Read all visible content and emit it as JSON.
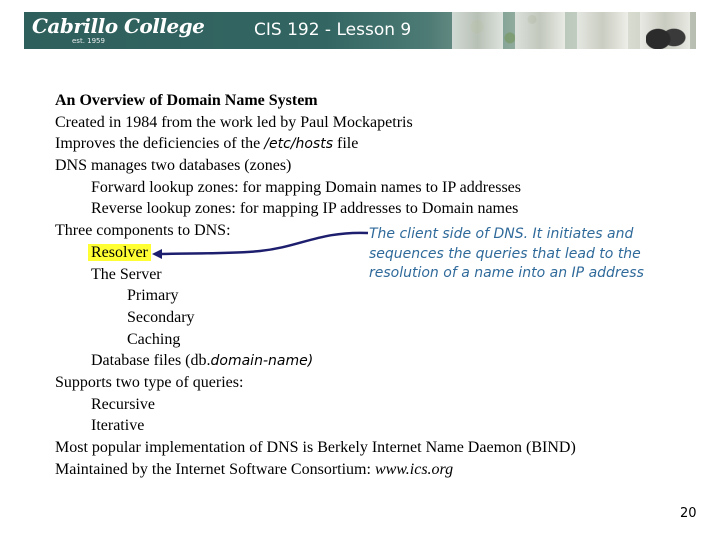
{
  "header": {
    "logo_text": "Cabrillo College",
    "logo_subtext": "est. 1959",
    "title": "CIS 192 - Lesson 9"
  },
  "content": {
    "heading": "An Overview of Domain Name System",
    "created": "Created in 1984 from the work led by Paul Mockapetris",
    "improves_prefix": "Improves the deficiencies of the ",
    "improves_file": "/etc/hosts",
    "improves_suffix": " file",
    "dns_manages": "DNS manages two databases (zones)",
    "forward": "Forward lookup zones: for mapping Domain names to IP addresses",
    "reverse": "Reverse lookup zones: for mapping IP addresses to Domain names",
    "three_components": "Three components to DNS:",
    "resolver": "Resolver",
    "server": "The Server",
    "primary": "Primary",
    "secondary": "Secondary",
    "caching": "Caching",
    "dbfiles_prefix": "Database files (db.",
    "dbfiles_name": "domain-name)",
    "supports": "Supports two type of queries:",
    "recursive": "Recursive",
    "iterative": "Iterative",
    "popular": "Most popular implementation of DNS is Berkely Internet Name Daemon (BIND)",
    "maintained_prefix": "Maintained by the Internet Software Consortium: ",
    "maintained_url": "www.ics.org"
  },
  "annotation": {
    "text": "The client side of DNS.  It initiates and sequences the queries that lead to the resolution of a name into an IP address",
    "color": "#2f6a9a",
    "highlight_color": "#ffff33"
  },
  "footer": {
    "page_number": "20"
  }
}
